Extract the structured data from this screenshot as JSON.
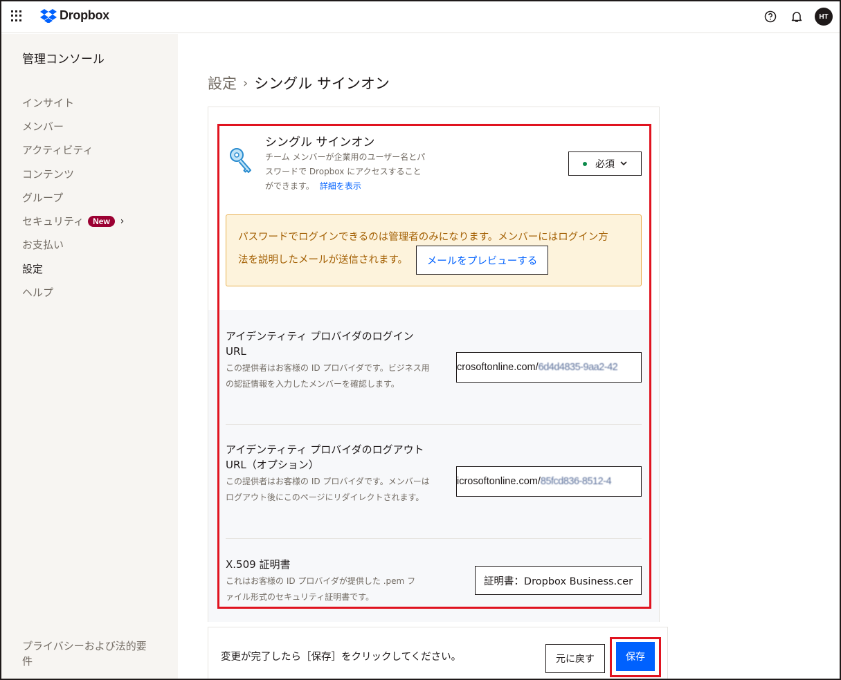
{
  "topbar": {
    "app_name": "Dropbox",
    "icons": [
      "apps-grid-icon",
      "help-icon",
      "bell-icon"
    ],
    "avatar_initials": "HT"
  },
  "sidebar": {
    "title": "管理コンソール",
    "items": [
      {
        "label": "インサイト"
      },
      {
        "label": "メンバー"
      },
      {
        "label": "アクティビティ"
      },
      {
        "label": "コンテンツ"
      },
      {
        "label": "グループ"
      },
      {
        "label": "セキュリティ",
        "badge": "New"
      },
      {
        "label": "お支払い"
      },
      {
        "label": "設定"
      },
      {
        "label": "ヘルプ"
      }
    ],
    "footer": "プライバシーおよび法的要件"
  },
  "breadcrumb": {
    "root": "設定",
    "separator": "›",
    "current": "シングル サインオン"
  },
  "sso": {
    "title": "シングル サインオン",
    "description": "チーム メンバーが企業用のユーザー名とパスワードで Dropbox にアクセスすることができます。",
    "details_link": "詳細を表示",
    "select_value": "必須",
    "status_color": "#0b8a4a"
  },
  "warning": {
    "line1": "パスワードでログインできるのは管理者のみになります。メンバーにはログイン方",
    "line2": "法を説明したメールが送信されます。",
    "preview_button": "メールをプレビューする"
  },
  "login_url": {
    "title": "アイデンティティ プロバイダのログイン URL",
    "description": "この提供者はお客様の ID プロバイダです。ビジネス用の認証情報を入力したメンバーを確認します。",
    "value_prefix": "crosoftonline.com/",
    "value_redacted": "6d4d4835-9aa2-42"
  },
  "logout_url": {
    "title": "アイデンティティ プロバイダのログアウト URL（オプション）",
    "description": "この提供者はお客様の ID プロバイダです。メンバーはログアウト後にこのページにリダイレクトされます。",
    "value_prefix": "icrosoftonline.com/",
    "value_redacted": "85fcd836-8512-4"
  },
  "certificate": {
    "title": "X.509 証明書",
    "description": "これはお客様の ID プロバイダが提供した .pem ファイル形式のセキュリティ証明書です。",
    "button": "証明書：Dropbox Business.cer"
  },
  "save_bar": {
    "message": "変更が完了したら［保存］をクリックしてください。",
    "revert_button": "元に戻す",
    "save_button": "保存"
  },
  "colors": {
    "accent": "#0061fe",
    "highlight_border": "#e0131f",
    "badge": "#9b0032",
    "warning_bg": "#fdf3dc",
    "warning_text": "#a46105"
  }
}
